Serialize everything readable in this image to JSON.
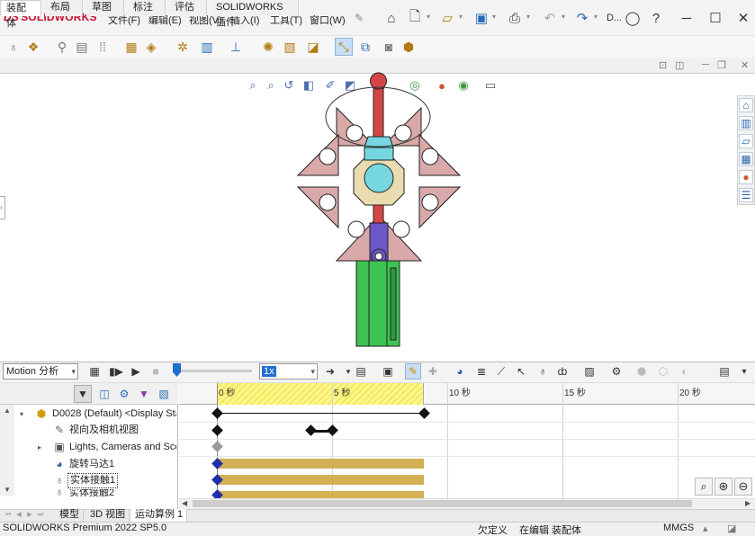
{
  "app": {
    "brand": "SOLIDWORKS",
    "brand_mark": "DS",
    "doc_title_short": "D..."
  },
  "menu": [
    "文件(F)",
    "编辑(E)",
    "视图(V)",
    "插入(I)",
    "工具(T)",
    "窗口(W)"
  ],
  "tabs": [
    "装配体",
    "布局",
    "草图",
    "标注",
    "评估",
    "SOLIDWORKS 插件"
  ],
  "motion": {
    "study_type": "Motion 分析",
    "speed": "1x",
    "slider_position": 0
  },
  "tree": {
    "root": "D0028 (Default) <Display Sta",
    "items": [
      {
        "label": "视向及相机视图"
      },
      {
        "label": "Lights, Cameras and Sce"
      },
      {
        "label": "旋转马达1"
      },
      {
        "label": "实体接触1"
      },
      {
        "label": "实体接触2"
      }
    ]
  },
  "timeline": {
    "ticks": [
      "0 秒",
      "5 秒",
      "10 秒",
      "15 秒",
      "20 秒"
    ]
  },
  "bottom_tabs": [
    "模型",
    "3D 视图",
    "运动算例 1"
  ],
  "status": {
    "version": "SOLIDWORKS Premium 2022 SP5.0",
    "state1": "欠定义",
    "state2": "在编辑 装配体",
    "units": "MMGS"
  },
  "colors": {
    "accent": "#c8102e",
    "selection": "#1f6fd1",
    "bar": "#d4b054",
    "hatch": "#fff78f",
    "petal": "#d9a9a9",
    "rod": "#d64545",
    "hub": "#e8dcb0",
    "cyan": "#76d7e0",
    "slider": "#6b57c9",
    "base": "#3ec253"
  }
}
